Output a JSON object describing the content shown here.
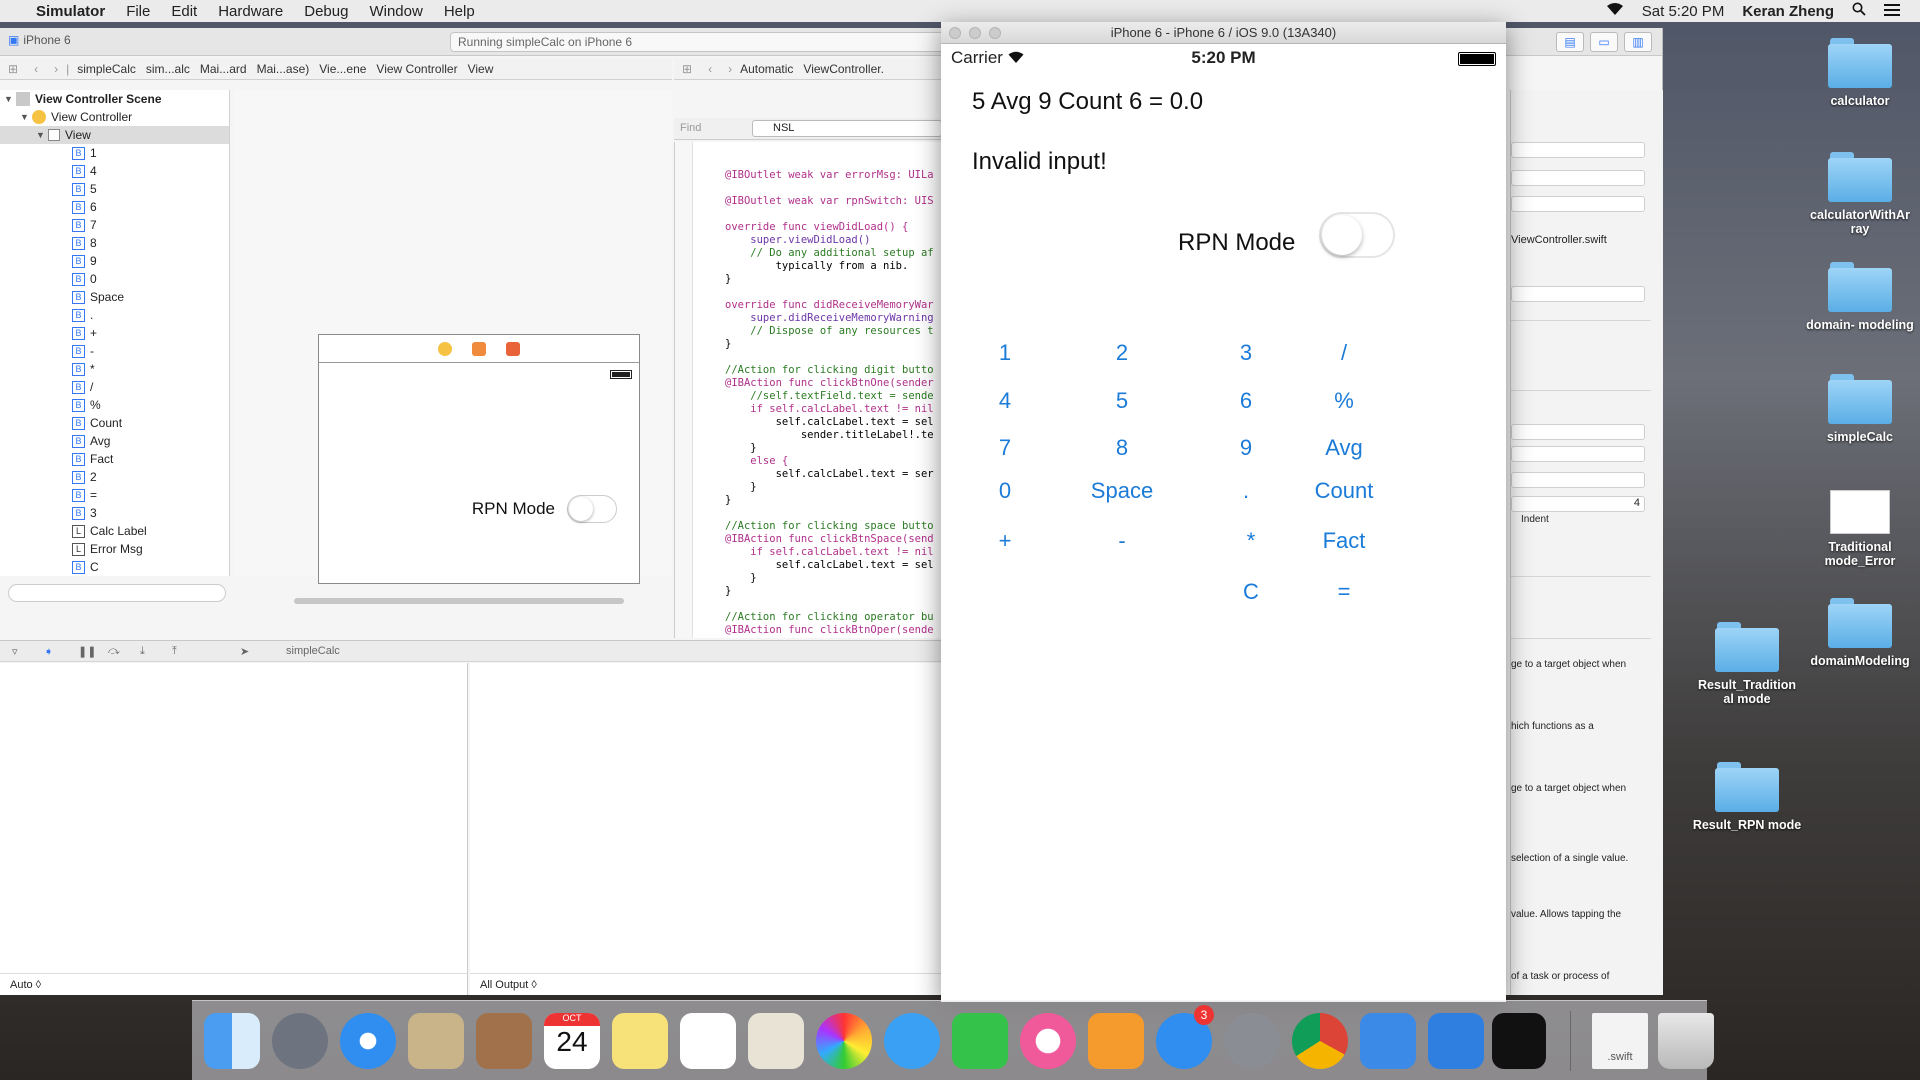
{
  "menubar": {
    "app": "Simulator",
    "items": [
      "File",
      "Edit",
      "Hardware",
      "Debug",
      "Window",
      "Help"
    ],
    "clock": "Sat 5:20 PM",
    "user": "Keran Zheng"
  },
  "xcode": {
    "scheme_device": "iPhone 6",
    "activity": "Running simpleCalc on iPhone 6",
    "jumpbar_left": [
      "simpleCalc",
      "sim...alc",
      "Mai...ard",
      "Mai...ase)",
      "Vie...ene",
      "View Controller",
      "View"
    ],
    "jumpbar_right": [
      "Automatic",
      "ViewController."
    ],
    "find_label": "Find",
    "find_value": "NSL",
    "outline": [
      {
        "label": "View Controller Scene",
        "kind": "scene",
        "indent": 0
      },
      {
        "label": "View Controller",
        "kind": "vc",
        "indent": 1
      },
      {
        "label": "View",
        "kind": "view",
        "indent": 2
      },
      {
        "label": "1",
        "kind": "B",
        "indent": 3
      },
      {
        "label": "4",
        "kind": "B",
        "indent": 3
      },
      {
        "label": "5",
        "kind": "B",
        "indent": 3
      },
      {
        "label": "6",
        "kind": "B",
        "indent": 3
      },
      {
        "label": "7",
        "kind": "B",
        "indent": 3
      },
      {
        "label": "8",
        "kind": "B",
        "indent": 3
      },
      {
        "label": "9",
        "kind": "B",
        "indent": 3
      },
      {
        "label": "0",
        "kind": "B",
        "indent": 3
      },
      {
        "label": "Space",
        "kind": "B",
        "indent": 3
      },
      {
        "label": ".",
        "kind": "B",
        "indent": 3
      },
      {
        "label": "+",
        "kind": "B",
        "indent": 3
      },
      {
        "label": "-",
        "kind": "B",
        "indent": 3
      },
      {
        "label": "*",
        "kind": "B",
        "indent": 3
      },
      {
        "label": "/",
        "kind": "B",
        "indent": 3
      },
      {
        "label": "%",
        "kind": "B",
        "indent": 3
      },
      {
        "label": "Count",
        "kind": "B",
        "indent": 3
      },
      {
        "label": "Avg",
        "kind": "B",
        "indent": 3
      },
      {
        "label": "Fact",
        "kind": "B",
        "indent": 3
      },
      {
        "label": "2",
        "kind": "B",
        "indent": 3
      },
      {
        "label": "=",
        "kind": "B",
        "indent": 3
      },
      {
        "label": "3",
        "kind": "B",
        "indent": 3
      },
      {
        "label": "Calc Label",
        "kind": "L",
        "indent": 3
      },
      {
        "label": "Error Msg",
        "kind": "L",
        "indent": 3
      },
      {
        "label": "C",
        "kind": "B",
        "indent": 3
      }
    ],
    "storyboard": {
      "rpn_label": "RPN Mode"
    },
    "code_lines": [
      "@IBOutlet weak var errorMsg: UILa",
      "",
      "@IBOutlet weak var rpnSwitch: UIS",
      "",
      "override func viewDidLoad() {",
      "    super.viewDidLoad()",
      "    // Do any additional setup af",
      "        typically from a nib.",
      "}",
      "",
      "override func didReceiveMemoryWar",
      "    super.didReceiveMemoryWarning",
      "    // Dispose of any resources t",
      "}",
      "",
      "//Action for clicking digit butto",
      "@IBAction func clickBtnOne(sender",
      "    //self.textField.text = sende",
      "    if self.calcLabel.text != nil",
      "        self.calcLabel.text = sel",
      "            sender.titleLabel!.te",
      "    }",
      "    else {",
      "        self.calcLabel.text = ser",
      "    }",
      "}",
      "",
      "//Action for clicking space butto",
      "@IBAction func clickBtnSpace(send",
      "    if self.calcLabel.text != nil",
      "        self.calcLabel.text = sel",
      "    }",
      "}",
      "",
      "//Action for clicking operator bu",
      "@IBAction func clickBtnOper(sende"
    ],
    "debug": {
      "target": "simpleCalc",
      "auto_label": "Auto ◊",
      "output_label": "All Output ◊"
    },
    "inspector": {
      "file": "ViewController.swift",
      "indent_label": "Indent",
      "indent_value": "4",
      "help": [
        "ge to a target object when",
        "hich functions as a",
        "ge to a target object when",
        "selection of a single value.",
        "value. Allows tapping the",
        "of a task or process of"
      ]
    }
  },
  "simulator": {
    "title": "iPhone 6 - iPhone 6 / iOS 9.0 (13A340)",
    "carrier": "Carrier",
    "time": "5:20 PM",
    "calc_label": "5 Avg 9 Count 6 = 0.0",
    "error_msg": "Invalid input!",
    "rpn_label": "RPN Mode",
    "rpn_on": false,
    "keys": {
      "k1": "1",
      "k2": "2",
      "k3": "3",
      "kdiv": "/",
      "k4": "4",
      "k5": "5",
      "k6": "6",
      "kmod": "%",
      "k7": "7",
      "k8": "8",
      "k9": "9",
      "kavg": "Avg",
      "k0": "0",
      "kspace": "Space",
      "kdot": ".",
      "kcount": "Count",
      "kplus": "+",
      "kminus": "-",
      "kmul": "*",
      "kfact": "Fact",
      "kclear": "C",
      "keq": "="
    }
  },
  "desktop": {
    "icons": [
      "calculator",
      "calculatorWithAr ray",
      "domain- modeling",
      "simpleCalc",
      "Traditional mode_Error",
      "domainModeling",
      "Result_Tradition al mode",
      "Result_RPN mode"
    ]
  },
  "dock": {
    "calendar_month": "OCT",
    "calendar_day": "24",
    "appstore_badge": "3",
    "swift_file": ".swift"
  },
  "colors": {
    "ios_blue": "#1a7bd8",
    "xcode_blue": "#3478f6"
  }
}
